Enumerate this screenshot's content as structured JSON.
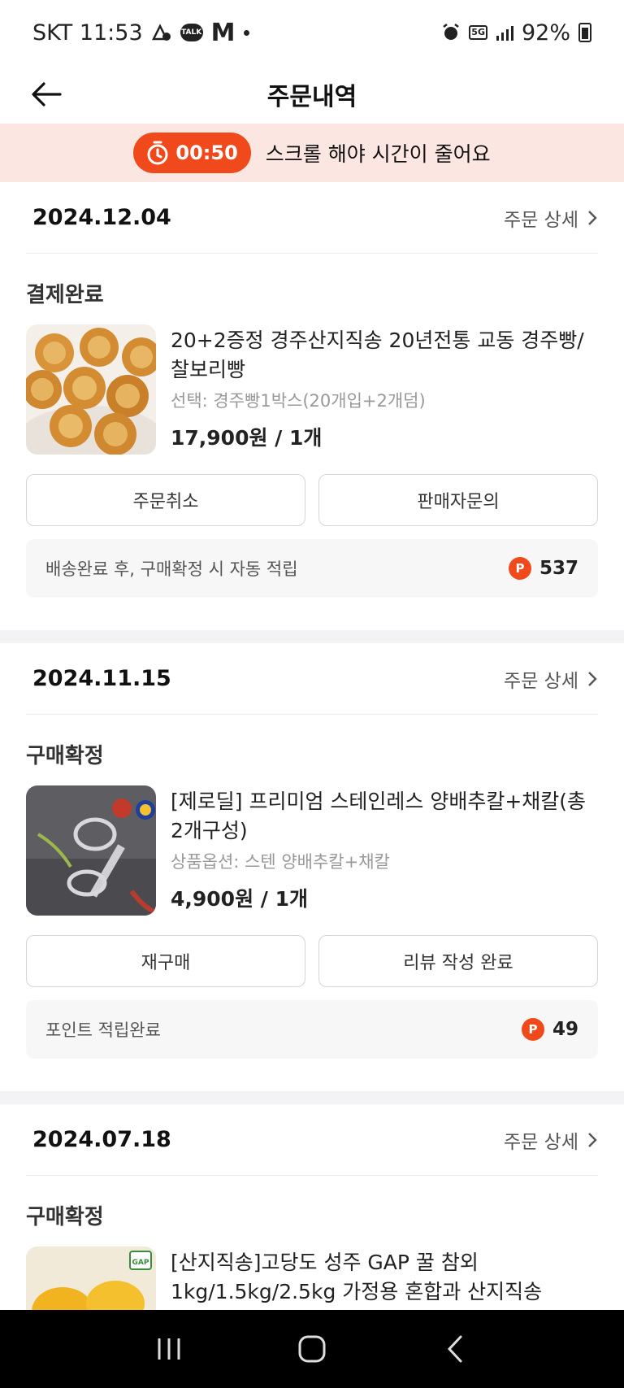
{
  "status_bar": {
    "carrier_time": "SKT 11:53",
    "talk_label": "TALK",
    "m_label": "M",
    "network": "5G",
    "battery": "92%"
  },
  "header": {
    "title": "주문내역"
  },
  "timer": {
    "time": "00:50",
    "message": "스크롤 해야 시간이 줄어요"
  },
  "orders": [
    {
      "date": "2024.12.04",
      "detail_label": "주문 상세",
      "status": "결제완료",
      "product_name": "20+2증정 경주산지직송 20년전통 교동 경주빵/찰보리빵",
      "option": "선택: 경주빵1박스(20개입+2개덤)",
      "price": "17,900원 / 1개",
      "button_left": "주문취소",
      "button_right": "판매자문의",
      "points_label": "배송완료 후, 구매확정 시 자동 적립",
      "points_icon": "P",
      "points_value": "537"
    },
    {
      "date": "2024.11.15",
      "detail_label": "주문 상세",
      "status": "구매확정",
      "product_name": "[제로딜] 프리미엄 스테인레스 양배추칼+채칼(총2개구성)",
      "option": "상품옵션: 스텐 양배추칼+채칼",
      "price": "4,900원 / 1개",
      "button_left": "재구매",
      "button_right": "리뷰 작성 완료",
      "points_label": "포인트 적립완료",
      "points_icon": "P",
      "points_value": "49"
    },
    {
      "date": "2024.07.18",
      "detail_label": "주문 상세",
      "status": "구매확정",
      "product_name": "[산지직송]고당도 성주 GAP 꿀 참외 1kg/1.5kg/2.5kg 가정용 혼합과 산지직송",
      "thumb_badge": "GAP"
    }
  ],
  "colors": {
    "accent": "#f04a1c",
    "banner_bg": "#fbe6e1",
    "separator": "#f3f3f5"
  }
}
